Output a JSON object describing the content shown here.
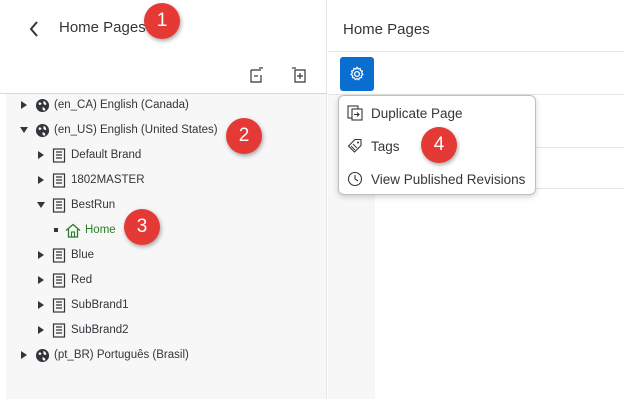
{
  "left": {
    "title": "Home Pages",
    "toolbar": [
      {
        "icon": "collapse-all-icon"
      },
      {
        "icon": "expand-all-icon"
      }
    ]
  },
  "tree": [
    {
      "label": "(en_CA) English (Canada)",
      "icon": "globe-icon",
      "expanded": false,
      "level": 0
    },
    {
      "label": "(en_US) English (United States)",
      "icon": "globe-icon",
      "expanded": true,
      "level": 0
    },
    {
      "label": "Default Brand",
      "icon": "building-icon",
      "expanded": false,
      "level": 1
    },
    {
      "label": "1802MASTER",
      "icon": "building-icon",
      "expanded": false,
      "level": 1
    },
    {
      "label": "BestRun",
      "icon": "building-icon",
      "expanded": true,
      "level": 1
    },
    {
      "label": "Home",
      "icon": "home-icon",
      "level": 2,
      "selected": true
    },
    {
      "label": "Blue",
      "icon": "building-icon",
      "expanded": false,
      "level": 1
    },
    {
      "label": "Red",
      "icon": "building-icon",
      "expanded": false,
      "level": 1
    },
    {
      "label": "SubBrand1",
      "icon": "building-icon",
      "expanded": false,
      "level": 1
    },
    {
      "label": "SubBrand2",
      "icon": "building-icon",
      "expanded": false,
      "level": 1
    },
    {
      "label": "(pt_BR) Português (Brasil)",
      "icon": "globe-icon",
      "expanded": false,
      "level": 0
    }
  ],
  "right": {
    "title": "Home Pages"
  },
  "menu": {
    "items": [
      {
        "label": "Duplicate Page",
        "icon": "duplicate-icon"
      },
      {
        "label": "Tags",
        "icon": "tag-icon"
      },
      {
        "label": "View Published Revisions",
        "icon": "clock-icon"
      }
    ]
  },
  "badges": [
    "1",
    "2",
    "3",
    "4"
  ],
  "colors": {
    "accent": "#0a6ed1",
    "badge": "#e53935",
    "home_green": "#2b7d2b"
  }
}
